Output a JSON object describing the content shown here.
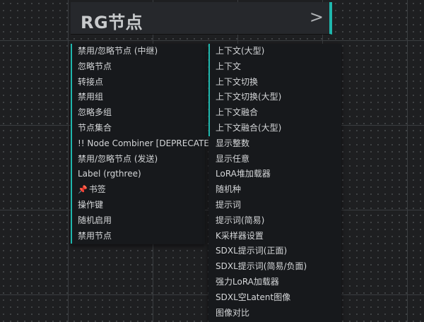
{
  "header": {
    "title": "RG节点",
    "chevron": ">"
  },
  "left_menu": {
    "items": [
      {
        "label": "禁用/忽略节点 (中继)",
        "accent": true
      },
      {
        "label": "忽略节点",
        "accent": true
      },
      {
        "label": "转接点",
        "accent": true
      },
      {
        "label": "禁用组",
        "accent": true
      },
      {
        "label": "忽略多组",
        "accent": true
      },
      {
        "label": "节点集合",
        "accent": true
      },
      {
        "label": "!! Node Combiner [DEPRECATED]",
        "accent": true
      },
      {
        "label": "禁用/忽略节点 (发送)",
        "accent": true
      },
      {
        "label": "Label (rgthree)",
        "accent": true
      },
      {
        "label": "书签",
        "accent": true,
        "icon": "pin-icon"
      },
      {
        "label": "操作键",
        "accent": true
      },
      {
        "label": "随机启用",
        "accent": true
      },
      {
        "label": "禁用节点",
        "accent": true
      }
    ]
  },
  "right_menu": {
    "items": [
      {
        "label": "上下文(大型)",
        "accent": true
      },
      {
        "label": "上下文",
        "accent": true
      },
      {
        "label": "上下文切换",
        "accent": true
      },
      {
        "label": "上下文切换(大型)",
        "accent": true
      },
      {
        "label": "上下文融合",
        "accent": true
      },
      {
        "label": "上下文融合(大型)",
        "accent": true
      },
      {
        "label": "显示整数",
        "accent": false
      },
      {
        "label": "显示任意",
        "accent": false
      },
      {
        "label": "LoRA堆加载器",
        "accent": false
      },
      {
        "label": "随机种",
        "accent": false
      },
      {
        "label": "提示词",
        "accent": false
      },
      {
        "label": "提示词(简易)",
        "accent": false
      },
      {
        "label": "K采样器设置",
        "accent": false
      },
      {
        "label": "SDXL提示词(正面)",
        "accent": false
      },
      {
        "label": "SDXL提示词(简易/负面)",
        "accent": false
      },
      {
        "label": "强力LoRA加载器",
        "accent": false
      },
      {
        "label": "SDXL空Latent图像",
        "accent": false
      },
      {
        "label": "图像对比",
        "accent": false
      }
    ]
  },
  "colors": {
    "accent": "#1fb7ad",
    "menu_bg": "#17191c",
    "canvas_bg": "#1e1f21"
  }
}
